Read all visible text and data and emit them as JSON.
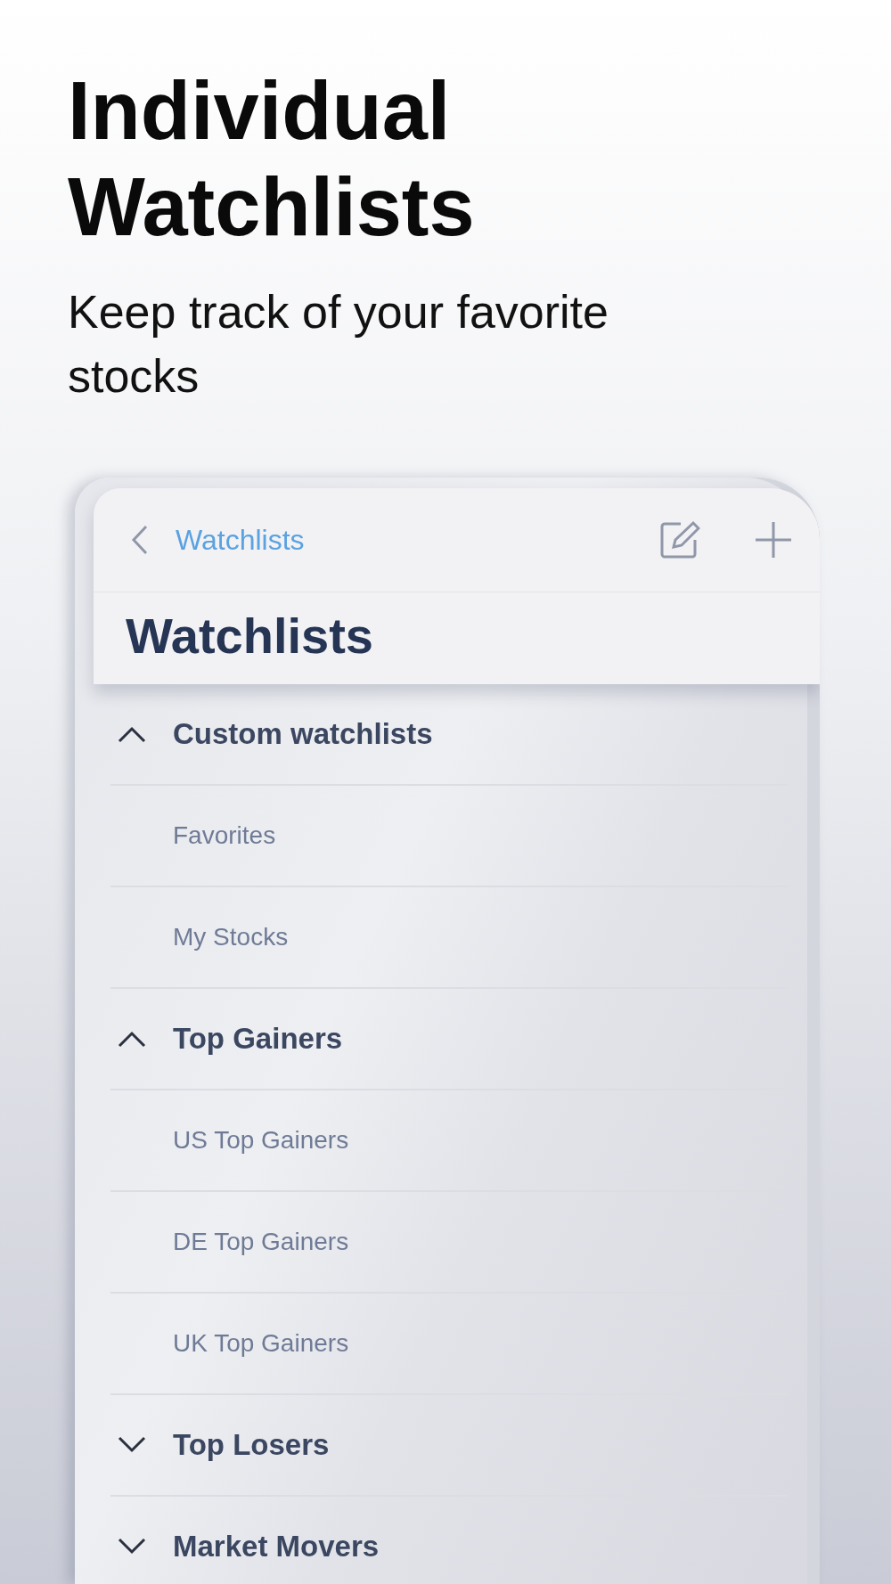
{
  "headline": "Individual Watchlists",
  "subtitle": "Keep track of your favorite stocks",
  "phone": {
    "back_label": "Watchlists",
    "title": "Watchlists",
    "groups": [
      {
        "label": "Custom watchlists",
        "expanded": true,
        "children": [
          {
            "label": "Favorites"
          },
          {
            "label": "My Stocks"
          }
        ]
      },
      {
        "label": "Top Gainers",
        "expanded": true,
        "children": [
          {
            "label": "US Top Gainers"
          },
          {
            "label": "DE Top Gainers"
          },
          {
            "label": "UK Top Gainers"
          }
        ]
      },
      {
        "label": "Top Losers",
        "expanded": false
      },
      {
        "label": "Market Movers",
        "expanded": false
      }
    ]
  }
}
